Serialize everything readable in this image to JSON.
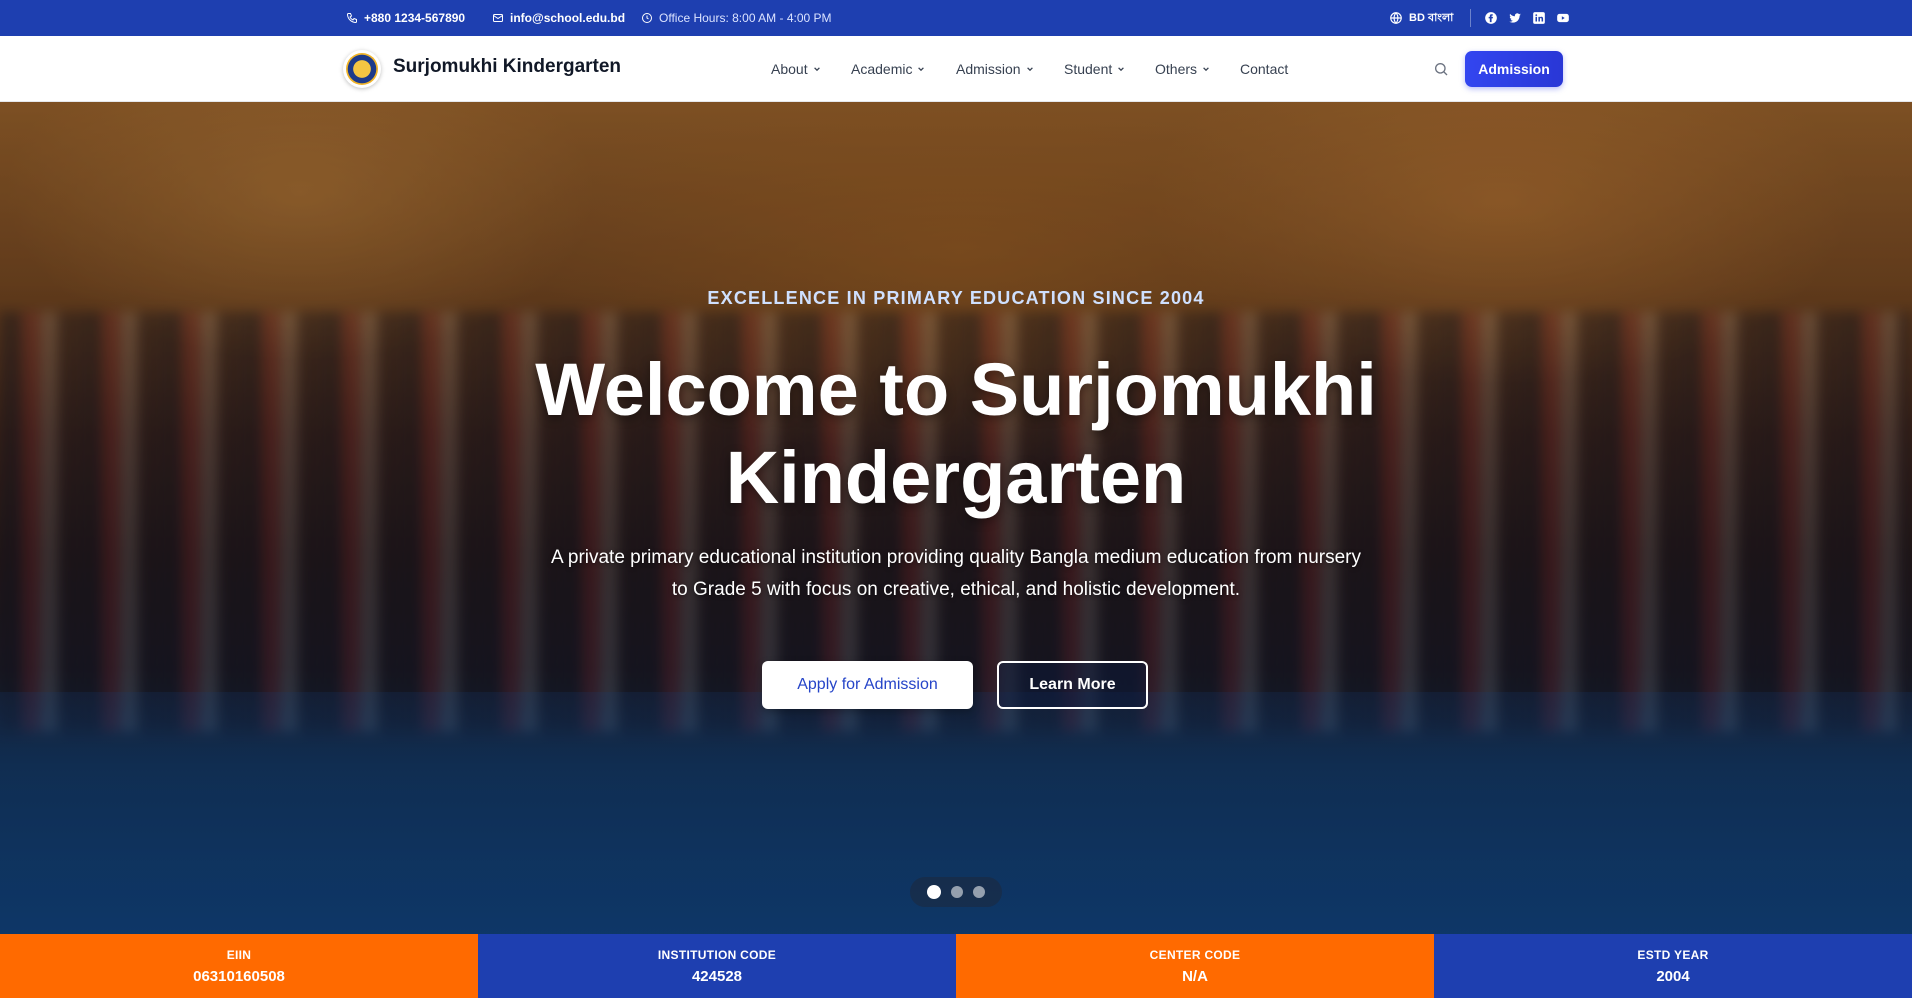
{
  "topbar": {
    "phone": "+880 1234-567890",
    "email": "info@school.edu.bd",
    "hours": "Office Hours: 8:00 AM - 4:00 PM",
    "language": "BD বাংলা",
    "social_icons": [
      "facebook-icon",
      "twitter-icon",
      "linkedin-icon",
      "youtube-icon"
    ]
  },
  "header": {
    "brand": "Surjomukhi Kindergarten",
    "nav": [
      {
        "label": "About",
        "dropdown": true
      },
      {
        "label": "Academic",
        "dropdown": true
      },
      {
        "label": "Admission",
        "dropdown": true
      },
      {
        "label": "Student",
        "dropdown": true
      },
      {
        "label": "Others",
        "dropdown": true
      },
      {
        "label": "Contact",
        "dropdown": false
      }
    ],
    "cta": "Admission"
  },
  "hero": {
    "eyebrow": "EXCELLENCE IN PRIMARY EDUCATION SINCE 2004",
    "title": "Welcome to Surjomukhi Kindergarten",
    "subtitle": "A private primary educational institution providing quality Bangla medium education from nursery to Grade 5 with focus on creative, ethical, and holistic development.",
    "primary_button": "Apply for Admission",
    "secondary_button": "Learn More",
    "slides": 3,
    "active_slide": 1
  },
  "info": [
    {
      "label": "EIIN",
      "value": "06310160508",
      "color": "#ff6a00"
    },
    {
      "label": "INSTITUTION CODE",
      "value": "424528",
      "color": "#1e3fb0"
    },
    {
      "label": "CENTER CODE",
      "value": "N/A",
      "color": "#ff6a00"
    },
    {
      "label": "ESTD YEAR",
      "value": "2004",
      "color": "#1e3fb0"
    }
  ],
  "colors": {
    "primary_blue": "#1e3fb0",
    "accent_orange": "#ff6a00",
    "button_blue": "#2e3fe8"
  }
}
